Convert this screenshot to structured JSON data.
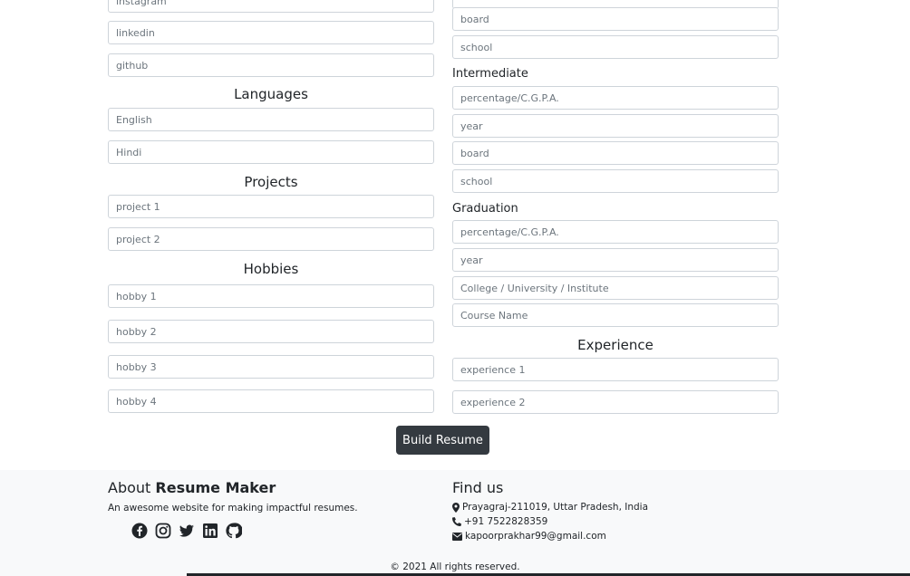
{
  "social_profiles": {
    "instagram_placeholder": "instagram",
    "linkedin_placeholder": "linkedin",
    "github_placeholder": "github"
  },
  "languages": {
    "title": "Languages",
    "items": [
      "English",
      "Hindi"
    ]
  },
  "projects": {
    "title": "Projects",
    "items": [
      "project 1",
      "project 2"
    ]
  },
  "hobbies": {
    "title": "Hobbies",
    "items": [
      "hobby 1",
      "hobby 2",
      "hobby 3",
      "hobby 4"
    ]
  },
  "education_top": {
    "board_placeholder": "board",
    "school_placeholder": "school"
  },
  "intermediate": {
    "title": "Intermediate",
    "percentage_placeholder": "percentage/C.G.P.A.",
    "year_placeholder": "year",
    "board_placeholder": "board",
    "school_placeholder": "school"
  },
  "graduation": {
    "title": "Graduation",
    "percentage_placeholder": "percentage/C.G.P.A.",
    "year_placeholder": "year",
    "college_placeholder": "College / University / Institute",
    "course_placeholder": "Course Name"
  },
  "experience": {
    "title": "Experience",
    "items": [
      "experience 1",
      "experience 2"
    ]
  },
  "build_button_label": "Build Resume",
  "footer": {
    "about_prefix": "About",
    "about_brand": "Resume Maker",
    "tagline": "An awesome website for making impactful resumes.",
    "find_us": "Find us",
    "address": "Prayagraj-211019, Uttar Pradesh, India",
    "phone": "+91 7522828359",
    "email": "kapoorprakhar99@gmail.com",
    "copyright": "© 2021 All rights reserved."
  }
}
